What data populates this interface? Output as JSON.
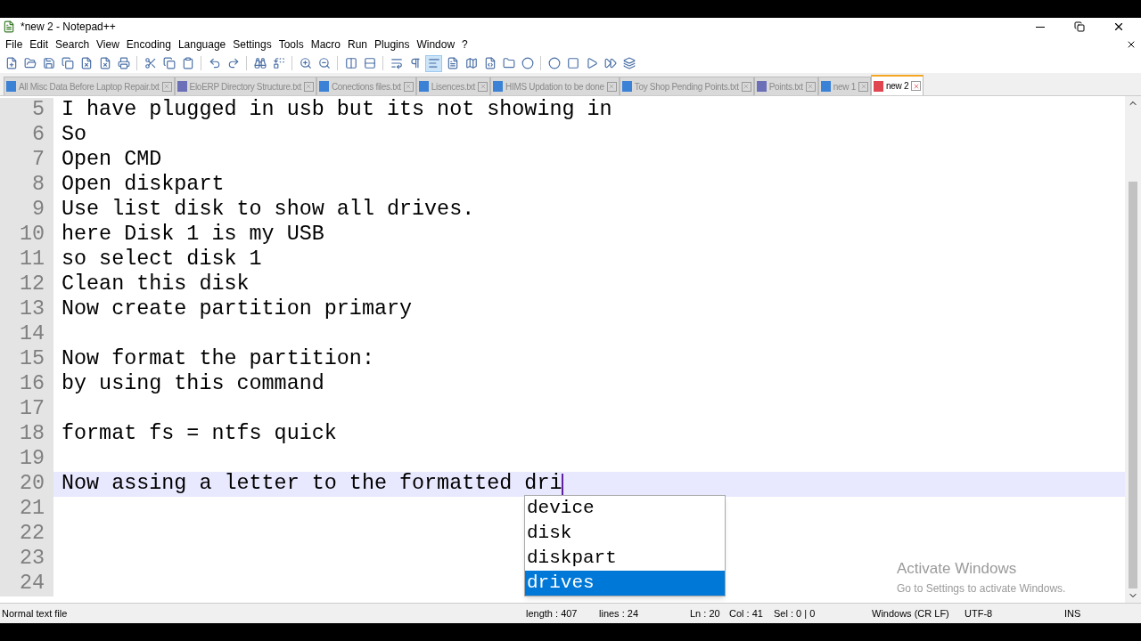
{
  "window": {
    "title": "*new 2 - Notepad++"
  },
  "menu": [
    "File",
    "Edit",
    "Search",
    "View",
    "Encoding",
    "Language",
    "Settings",
    "Tools",
    "Macro",
    "Run",
    "Plugins",
    "Window",
    "?"
  ],
  "tabs": [
    {
      "label": "All Misc Data Before Laptop Repair.txt",
      "selected": false,
      "color": "#3b82d6"
    },
    {
      "label": "EloERP Directory Structure.txt",
      "selected": false,
      "color": "#6b6fb8"
    },
    {
      "label": "Conections files.txt",
      "selected": false,
      "color": "#3b82d6"
    },
    {
      "label": "Lisences.txt",
      "selected": false,
      "color": "#3b82d6"
    },
    {
      "label": "HIMS Updation to be done",
      "selected": false,
      "color": "#3b82d6"
    },
    {
      "label": "Toy Shop Pending Points.txt",
      "selected": false,
      "color": "#3b82d6"
    },
    {
      "label": "Points.txt",
      "selected": false,
      "color": "#6b6fb8"
    },
    {
      "label": "new 1",
      "selected": false,
      "color": "#3b82d6"
    },
    {
      "label": "new 2",
      "selected": true,
      "color": "#e0464f"
    }
  ],
  "editor": {
    "lines": [
      {
        "number": "5",
        "text": "I have plugged in usb but its not showing in",
        "current": false
      },
      {
        "number": "6",
        "text": "So",
        "current": false
      },
      {
        "number": "7",
        "text": "Open CMD",
        "current": false
      },
      {
        "number": "8",
        "text": "Open diskpart",
        "current": false
      },
      {
        "number": "9",
        "text": "Use list disk to show all drives.",
        "current": false
      },
      {
        "number": "10",
        "text": "here Disk 1 is my USB",
        "current": false
      },
      {
        "number": "11",
        "text": "so select disk 1",
        "current": false
      },
      {
        "number": "12",
        "text": "Clean this disk",
        "current": false
      },
      {
        "number": "13",
        "text": "Now create partition primary",
        "current": false
      },
      {
        "number": "14",
        "current": false
      },
      {
        "number": "15",
        "text": "Now format the partition:",
        "current": false
      },
      {
        "number": "16",
        "text": "by using this command",
        "current": false
      },
      {
        "number": "17",
        "current": false
      },
      {
        "number": "18",
        "text": "format fs = ntfs quick",
        "current": false
      },
      {
        "number": "19",
        "current": false
      },
      {
        "number": "20",
        "text": "Now assing a letter to the formatted dri",
        "current": true
      },
      {
        "number": "21",
        "current": false
      },
      {
        "number": "22",
        "current": false
      },
      {
        "number": "23",
        "current": false
      },
      {
        "number": "24",
        "current": false
      }
    ],
    "autocomplete": [
      {
        "label": "device",
        "selected": false
      },
      {
        "label": "disk",
        "selected": false
      },
      {
        "label": "diskpart",
        "selected": false
      },
      {
        "label": "drives",
        "selected": true
      }
    ]
  },
  "activation_notice": {
    "title": "Activate Windows",
    "subtitle": "Go to Settings to activate Windows."
  },
  "status_bar": {
    "file_type": "Normal text file",
    "length": "length : 407",
    "lines": "lines : 24",
    "line": "Ln : 20",
    "column": "Col : 41",
    "selection": "Sel : 0 | 0",
    "eol": "Windows (CR LF)",
    "encoding": "UTF-8",
    "mode": "INS"
  }
}
